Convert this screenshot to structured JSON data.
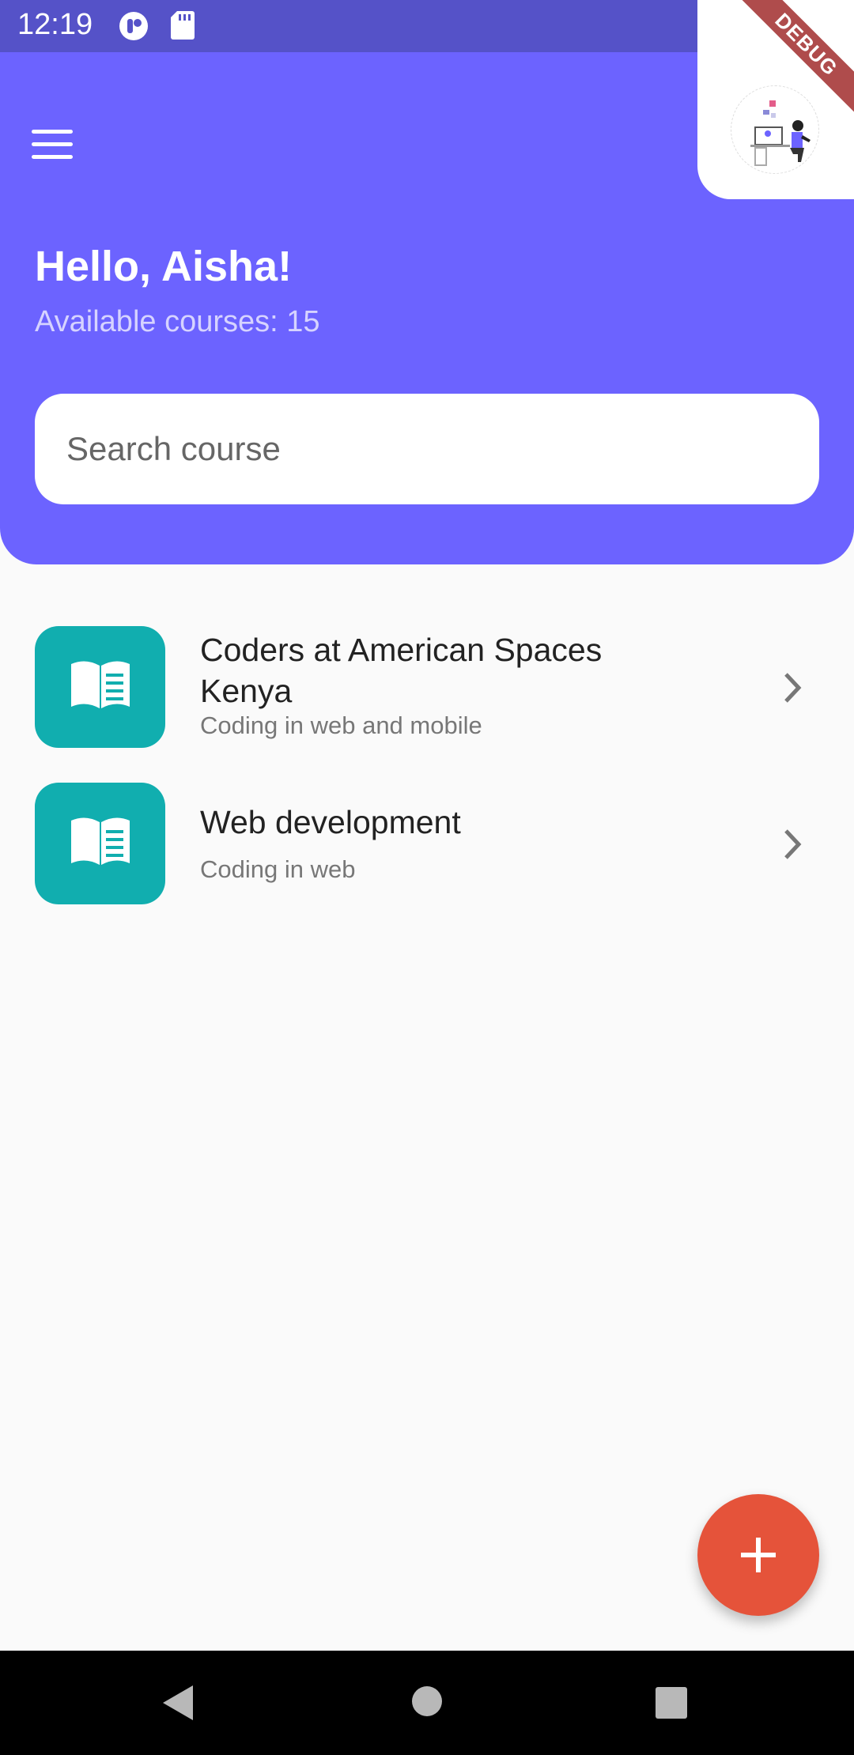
{
  "status_bar": {
    "time": "12:19"
  },
  "debug_banner": "DEBUG",
  "header": {
    "greeting": "Hello, Aisha!",
    "subtitle": "Available courses: 15"
  },
  "search": {
    "placeholder": "Search course"
  },
  "courses": [
    {
      "title": "Coders at American Spaces Kenya",
      "subtitle": "Coding in web and mobile",
      "icon": "book-icon"
    },
    {
      "title": "Web development",
      "subtitle": "Coding in web",
      "icon": "book-icon"
    }
  ],
  "fab": {
    "icon": "add-icon"
  },
  "colors": {
    "header": "#6c63ff",
    "status_bar": "#5552c8",
    "course_icon_bg": "#11aeaf",
    "fab": "#e5533a"
  }
}
